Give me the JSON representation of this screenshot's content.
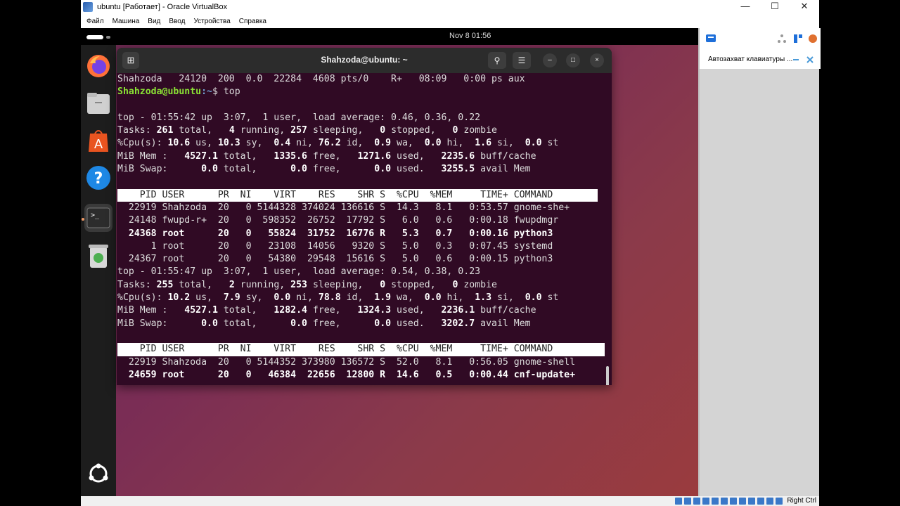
{
  "window": {
    "title": "ubuntu [Работает] - Oracle VirtualBox",
    "minimize": "—",
    "maximize": "☐",
    "close": "✕"
  },
  "menu": [
    "Файл",
    "Машина",
    "Вид",
    "Ввод",
    "Устройства",
    "Справка"
  ],
  "topbar": {
    "clock": "Nov 8  01:56"
  },
  "terminal": {
    "title": "Shahzoda@ubuntu: ~",
    "new_tab": "⊞",
    "search": "⚲",
    "menu": "☰",
    "minimize": "–",
    "maximize": "□",
    "close": "×"
  },
  "lines": {
    "l1": "Shahzoda   24120  200  0.0  22284  4608 pts/0    R+   08:09   0:00 ps aux",
    "prompt_user": "Shahzoda@ubuntu",
    "prompt_path": ":~",
    "prompt_cmd": "$ top",
    "top1_a": "top - 01:55:42 up  3:07,  1 user,  load average: 0.46, 0.36, 0.22",
    "t1_tasks": [
      "Tasks: ",
      "261",
      " total,   ",
      "4",
      " running, ",
      "257",
      " sleeping,   ",
      "0",
      " stopped,   ",
      "0",
      " zombie"
    ],
    "t1_cpu": [
      "%Cpu(s): ",
      "10.6",
      " us, ",
      "10.3",
      " sy,  ",
      "0.4",
      " ni, ",
      "76.2",
      " id,  ",
      "0.9",
      " wa,  ",
      "0.0",
      " hi,  ",
      "1.6",
      " si,  ",
      "0.0",
      " st"
    ],
    "t1_mem": [
      "MiB Mem :   ",
      "4527.1",
      " total,   ",
      "1335.6",
      " free,   ",
      "1271.6",
      " used,   ",
      "2235.6",
      " buff/cache"
    ],
    "t1_swap": [
      "MiB Swap:      ",
      "0.0",
      " total,      ",
      "0.0",
      " free,      ",
      "0.0",
      " used.   ",
      "3255.5",
      " avail Mem"
    ],
    "header": "    PID USER      PR  NI    VIRT    RES    SHR S  %CPU  %MEM     TIME+ COMMAND",
    "p1": "  22919 Shahzoda  20   0 5144328 374024 136616 S  14.3   8.1   0:53.57 gnome-she+",
    "p2": "  24148 fwupd-r+  20   0  598352  26752  17792 S   6.0   0.6   0:00.18 fwupdmgr",
    "p3": "  24368 root      20   0   55824  31752  16776 R   5.3   0.7   0:00.16 python3",
    "p4": "      1 root      20   0   23108  14056   9320 S   5.0   0.3   0:07.45 systemd",
    "p5": "  24367 root      20   0   54380  29548  15616 S   5.0   0.6   0:00.15 python3",
    "top2_a": "top - 01:55:47 up  3:07,  1 user,  load average: 0.54, 0.38, 0.23",
    "t2_tasks": [
      "Tasks: ",
      "255",
      " total,   ",
      "2",
      " running, ",
      "253",
      " sleeping,   ",
      "0",
      " stopped,   ",
      "0",
      " zombie"
    ],
    "t2_cpu": [
      "%Cpu(s): ",
      "10.2",
      " us,  ",
      "7.9",
      " sy,  ",
      "0.0",
      " ni, ",
      "78.8",
      " id,  ",
      "1.9",
      " wa,  ",
      "0.0",
      " hi,  ",
      "1.3",
      " si,  ",
      "0.0",
      " st"
    ],
    "t2_mem": [
      "MiB Mem :   ",
      "4527.1",
      " total,   ",
      "1282.4",
      " free,   ",
      "1324.3",
      " used,   ",
      "2236.1",
      " buff/cache"
    ],
    "t2_swap": [
      "MiB Swap:      ",
      "0.0",
      " total,      ",
      "0.0",
      " free,      ",
      "0.0",
      " used.   ",
      "3202.7",
      " avail Mem"
    ],
    "q1": "  22919 Shahzoda  20   0 5144352 373980 136572 S  52.0   8.1   0:56.05 gnome-shell",
    "q2": "  24659 root      20   0   46384  22656  12800 R  14.6   0.5   0:00.44 cnf-update+"
  },
  "panel": {
    "keyboard_capture": "Автозахват клавиатуры ..."
  },
  "status": {
    "host_key": "Right Ctrl"
  }
}
